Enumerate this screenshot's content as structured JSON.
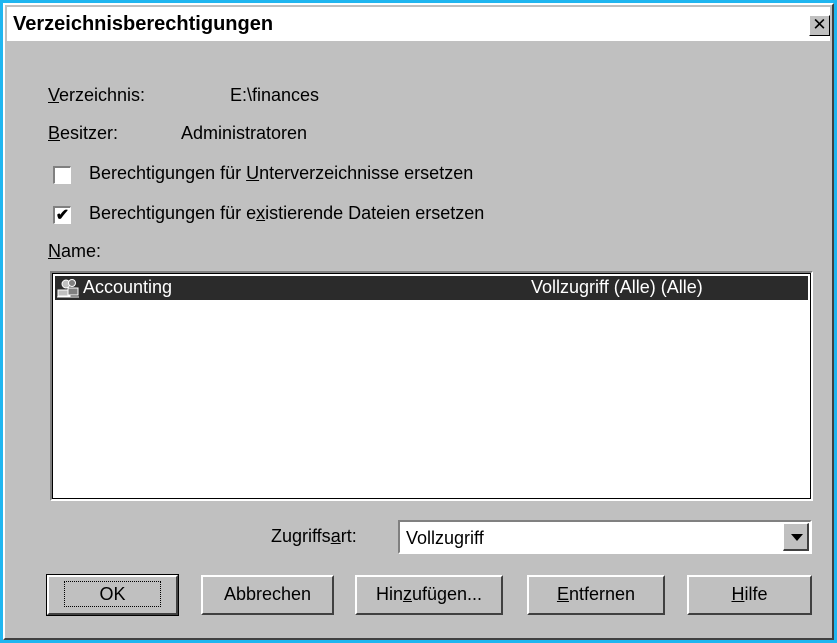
{
  "window": {
    "title": "Verzeichnisberechtigungen",
    "close_glyph": "✕"
  },
  "fields": {
    "directory_label": "Verzeichnis:",
    "directory_value": "E:\\finances",
    "owner_label": "Besitzer:",
    "owner_value": "Administratoren"
  },
  "options": {
    "replace_subdirs_label": "Berechtigungen für Unterverzeichnisse ersetzen",
    "replace_subdirs_checked": false,
    "replace_files_label": "Berechtigungen für existierende Dateien ersetzen",
    "replace_files_checked": true,
    "check_glyph": "✔"
  },
  "list": {
    "header": "Name:",
    "rows": [
      {
        "icon": "group-icon",
        "name": "Accounting",
        "permission": "Vollzugriff (Alle) (Alle)",
        "selected": true
      }
    ]
  },
  "access": {
    "label": "Zugriffsart:",
    "value": "Vollzugriff"
  },
  "buttons": {
    "ok": "OK",
    "cancel": "Abbrechen",
    "add": "Hinzufügen...",
    "remove": "Entfernen",
    "help": "Hilfe"
  },
  "colors": {
    "desktop": "#1fb6f0",
    "dialog": "#c0c0c0",
    "selection": "#2b2b2b"
  }
}
